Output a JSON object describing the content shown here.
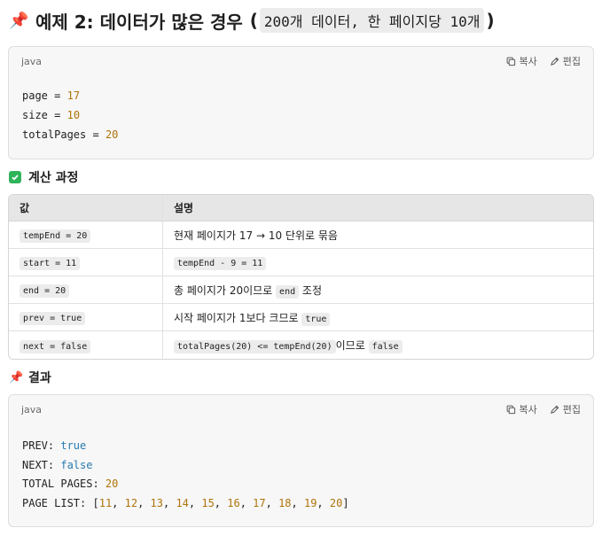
{
  "heading": {
    "title": "예제 2: 데이터가 많은 경우",
    "paren_open": "(",
    "paren_code": "200개 데이터, 한 페이지당 10개",
    "paren_close": ")"
  },
  "code1": {
    "lang": "java",
    "copy_label": "복사",
    "edit_label": "편집",
    "lines": [
      {
        "key": "page",
        "op": " = ",
        "val": "17"
      },
      {
        "key": "size",
        "op": " = ",
        "val": "10"
      },
      {
        "key": "totalPages",
        "op": " = ",
        "val": "20"
      }
    ]
  },
  "section_calc": {
    "title": "계산 과정"
  },
  "table": {
    "headers": [
      "값",
      "설명"
    ],
    "rows": [
      {
        "value": "tempEnd = 20",
        "desc": [
          {
            "t": "text",
            "v": "현재 페이지가 17 → 10 단위로 묶음"
          }
        ]
      },
      {
        "value": "start = 11",
        "desc": [
          {
            "t": "code",
            "v": "tempEnd - 9 = 11"
          }
        ]
      },
      {
        "value": "end = 20",
        "desc": [
          {
            "t": "text",
            "v": "총 페이지가 20이므로 "
          },
          {
            "t": "code",
            "v": "end"
          },
          {
            "t": "text",
            "v": " 조정"
          }
        ]
      },
      {
        "value": "prev = true",
        "desc": [
          {
            "t": "text",
            "v": "시작 페이지가 1보다 크므로 "
          },
          {
            "t": "code",
            "v": "true"
          }
        ]
      },
      {
        "value": "next = false",
        "desc": [
          {
            "t": "code",
            "v": "totalPages(20) <= tempEnd(20)"
          },
          {
            "t": "text",
            "v": "이므로 "
          },
          {
            "t": "code",
            "v": "false"
          }
        ]
      }
    ]
  },
  "section_result": {
    "title": "결과"
  },
  "code2": {
    "lang": "java",
    "copy_label": "복사",
    "edit_label": "편집",
    "prev_label": "PREV: ",
    "prev_val": "true",
    "next_label": "NEXT: ",
    "next_val": "false",
    "total_label": "TOTAL PAGES: ",
    "total_val": "20",
    "list_label": "PAGE LIST: ",
    "list": [
      "11",
      "12",
      "13",
      "14",
      "15",
      "16",
      "17",
      "18",
      "19",
      "20"
    ]
  },
  "colors": {
    "pin": "#d62b2b",
    "check": "#2fb45a",
    "number": "#b0730b",
    "keyword": "#2a7ab0"
  },
  "icons": [
    "pushpin-icon",
    "copy-icon",
    "edit-icon",
    "check-icon"
  ]
}
